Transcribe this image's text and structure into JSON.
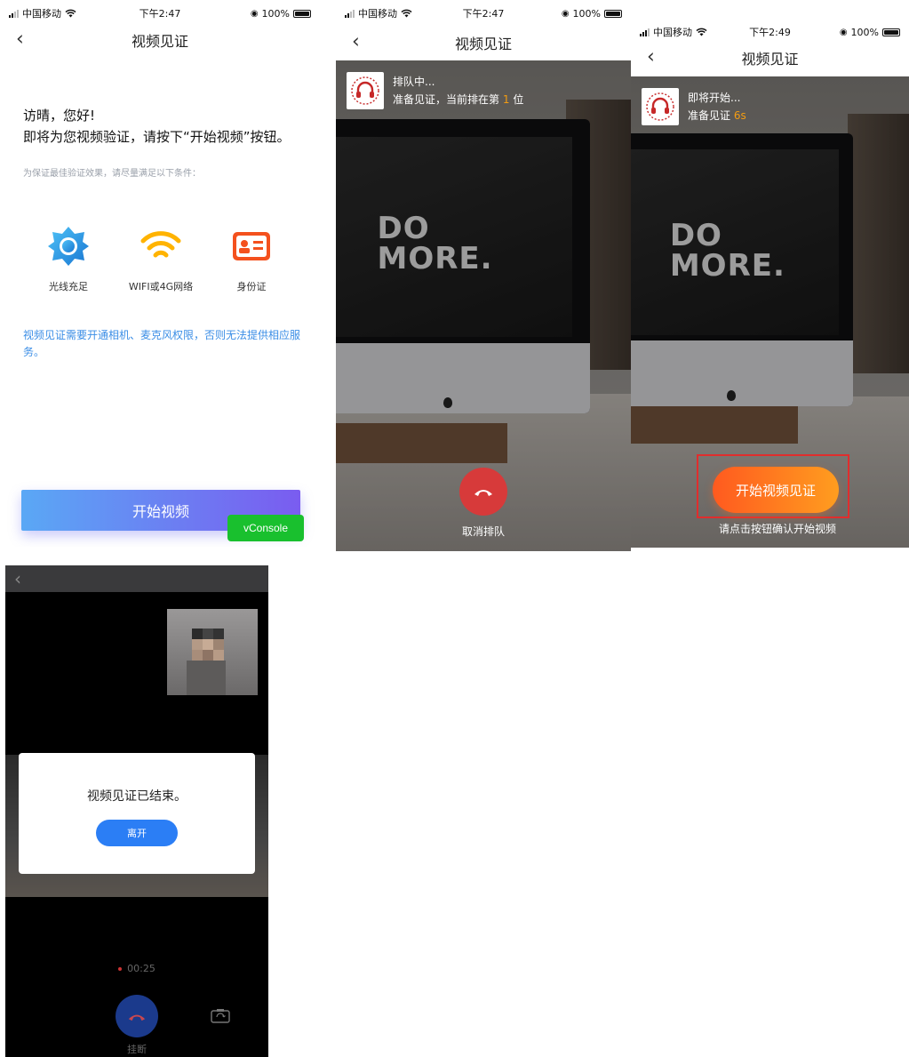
{
  "panel1": {
    "status": {
      "carrier": "中国移动",
      "time": "下午2:47",
      "battery": "100%"
    },
    "title": "视频见证",
    "greeting_line1": "访晴，您好!",
    "greeting_line2": "即将为您视频验证，请按下“开始视频”按钮。",
    "hint": "为保证最佳验证效果，请尽量满足以下条件：",
    "conditions": [
      {
        "label": "光线充足",
        "icon": "sun-icon"
      },
      {
        "label": "WIFI或4G网络",
        "icon": "wifi-icon"
      },
      {
        "label": "身份证",
        "icon": "id-card-icon"
      }
    ],
    "notice": "视频见证需要开通相机、麦克风权限，否则无法提供相应服务。",
    "start_button": "开始视频",
    "vconsole": "vConsole",
    "colors": {
      "link": "#3b8ee6",
      "gradient_start": "#5aa8f5",
      "gradient_end": "#7a5cf0",
      "vconsole": "#19c02e"
    }
  },
  "panel2": {
    "status": {
      "carrier": "中国移动",
      "time": "下午2:47",
      "battery": "100%"
    },
    "title": "视频见证",
    "queue_title": "排队中...",
    "queue_text_prefix": "准备见证，当前排在第",
    "queue_position": "1",
    "queue_text_suffix": "位",
    "screen_text_line1": "DO",
    "screen_text_line2": "MORE.",
    "cancel_label": "取消排队",
    "colors": {
      "hangup": "#d73a3a"
    }
  },
  "panel3": {
    "status": {
      "carrier": "中国移动",
      "time": "下午2:49",
      "battery": "100%"
    },
    "title": "视频见证",
    "starting_title": "即将开始...",
    "ready_text": "准备见证",
    "countdown": "6s",
    "screen_text_line1": "DO",
    "screen_text_line2": "MORE.",
    "start_button": "开始视频见证",
    "confirm_caption": "请点击按钮确认开始视频",
    "colors": {
      "highlight": "#e02d2d",
      "button_start": "#ff5a1f",
      "button_end": "#ff9d1f"
    }
  },
  "panel4": {
    "dialog_message": "视频见证已结束。",
    "leave_button": "离开",
    "timer": "00:25",
    "hangup_label": "挂断",
    "colors": {
      "leave": "#2b7ef5",
      "hangup": "#1b3a8c"
    }
  }
}
